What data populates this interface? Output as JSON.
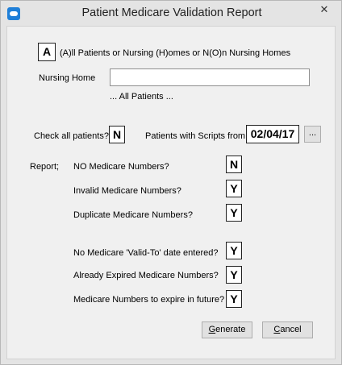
{
  "window": {
    "title": "Patient Medicare Validation Report",
    "close_glyph": "✕"
  },
  "selection": {
    "value": "A",
    "description": "(A)ll Patients or Nursing (H)omes or N(O)n Nursing Homes"
  },
  "nursing_home": {
    "label": "Nursing Home",
    "value": "",
    "hint": "... All Patients ..."
  },
  "check_all": {
    "label": "Check all patients?",
    "value": "N"
  },
  "scripts_from": {
    "label": "Patients with Scripts from",
    "value": "02/04/17",
    "browse_label": "..."
  },
  "report": {
    "label": "Report;",
    "options": [
      {
        "label": "NO Medicare Numbers?",
        "value": "N"
      },
      {
        "label": "Invalid Medicare Numbers?",
        "value": "Y"
      },
      {
        "label": "Duplicate Medicare Numbers?",
        "value": "Y"
      },
      {
        "label": "No Medicare 'Valid-To' date entered?",
        "value": "Y"
      },
      {
        "label": "Already Expired Medicare Numbers?",
        "value": "Y"
      },
      {
        "label": "Medicare Numbers to expire in future?",
        "value": "Y"
      }
    ]
  },
  "buttons": {
    "generate": {
      "accel": "G",
      "rest": "enerate"
    },
    "cancel": {
      "accel": "C",
      "rest": "ancel"
    }
  }
}
